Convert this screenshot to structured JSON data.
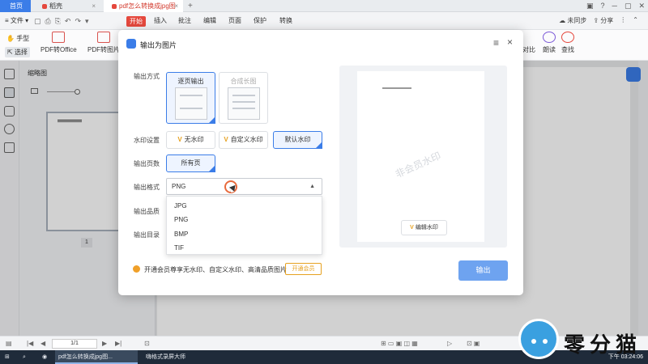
{
  "tabs": {
    "home": "首页",
    "daoke": "稻壳",
    "pdf": "pdf怎么转换成jpg图片.pdf",
    "plus": "+"
  },
  "menubar": {
    "file": "文件",
    "start": "开始",
    "items": [
      "插入",
      "批注",
      "编辑",
      "页面",
      "保护",
      "转换"
    ],
    "sync": "未同步",
    "share": "分享"
  },
  "ribbon": {
    "hand": "手型",
    "select": "选择",
    "pdf_to_office": "PDF转Office",
    "pdf_to_image": "PDF转图片",
    "compare": "对比",
    "read_aloud": "朗读",
    "find": "查找"
  },
  "thumbnails": {
    "title": "缩略图",
    "page_label": "1"
  },
  "dialog": {
    "title": "输出为图片",
    "output_mode_label": "输出方式",
    "mode_page": "逐页输出",
    "mode_long": "合成长图",
    "watermark_label": "水印设置",
    "wm_none": "无水印",
    "wm_custom": "自定义水印",
    "wm_default": "默认水印",
    "pages_label": "输出页数",
    "pages_value": "所有页",
    "format_label": "输出格式",
    "format_value": "PNG",
    "format_options": [
      "JPG",
      "PNG",
      "BMP",
      "TIF"
    ],
    "quality_label": "输出品质",
    "dir_label": "输出目录",
    "promo_text": "开通会员尊享无水印、自定义水印、高清品质图片",
    "member_btn": "开通会员",
    "preview_watermark": "非会员水印",
    "edit_watermark": "编辑水印",
    "export_btn": "输出"
  },
  "statusbar": {
    "page": "1/1"
  },
  "taskbar": {
    "app1": "pdf怎么转换成jpg图...",
    "app2": "嗨格式录屏大师",
    "clock": "下午 03:24:06"
  },
  "logo": {
    "text": "零分猫"
  },
  "colors": {
    "accent": "#3b7de8",
    "start_tab": "#e5483d",
    "vip_gold": "#e6a120"
  }
}
